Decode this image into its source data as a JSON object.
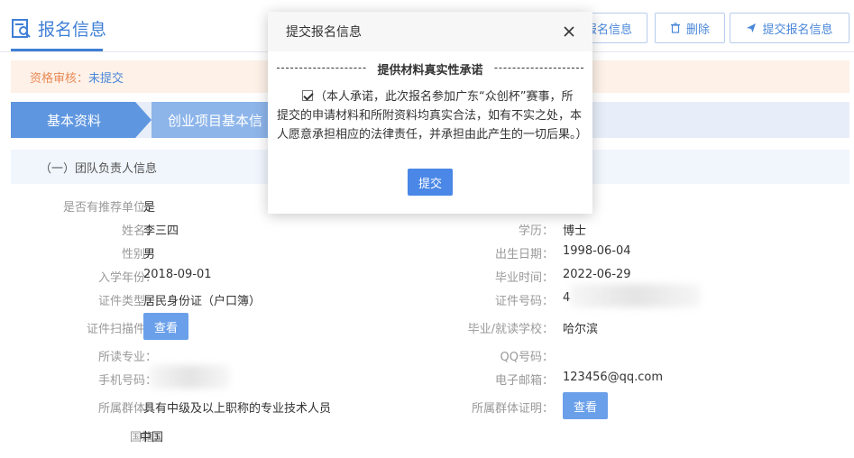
{
  "header": {
    "title": "报名信息",
    "buttons": {
      "edit": "报名信息",
      "delete": "删除",
      "submit": "提交报名信息"
    }
  },
  "status": {
    "label": "资格审核：",
    "value": "未提交"
  },
  "steps": [
    "基本资料",
    "创业项目基本信"
  ],
  "section": {
    "title": "（一）团队负责人信息"
  },
  "form": {
    "recommend_label": "是否有推荐单位：",
    "recommend_value": "是",
    "name_label": "姓名：",
    "name_value": "李三四",
    "edu_label": "学历：",
    "edu_value": "博士",
    "gender_label": "性别：",
    "gender_value": "男",
    "birth_label": "出生日期：",
    "birth_value": "1998-06-04",
    "enroll_label": "入学年份：",
    "enroll_value": "2018-09-01",
    "grad_label": "毕业时间：",
    "grad_value": "2022-06-29",
    "idtype_label": "证件类型：",
    "idtype_value": "居民身份证（户口簿）",
    "idno_label": "证件号码：",
    "idno_value": "4",
    "scan_label": "证件扫描件：",
    "view_label": "查看",
    "school_label": "毕业/就读学校：",
    "school_value": "哈尔滨",
    "major_label": "所读专业：",
    "qq_label": "QQ号码：",
    "phone_label": "手机号码：",
    "email_label": "电子邮箱：",
    "email_value": "123456@qq.com",
    "group_label": "所属群体：",
    "group_value": "具有中级及以上职称的专业技术人员",
    "group_proof_label": "所属群体证明：",
    "group_proof_view": "查看",
    "nation_label": "国籍：",
    "nation_value": "中国"
  },
  "modal": {
    "title": "提交报名信息",
    "commit_title": "提供材料真实性承诺",
    "commit_text": "（本人承诺，此次报名参加广东“众创杯”赛事，所提交的申请材料和所附资料均真实合法，如有不实之处，本人愿意承担相应的法律责任，并承担由此产生的一切后果。）",
    "submit": "提交"
  },
  "colors": {
    "accent": "#3f7fd6",
    "status_bg": "#fdf1e8",
    "status_key": "#e98a55"
  }
}
